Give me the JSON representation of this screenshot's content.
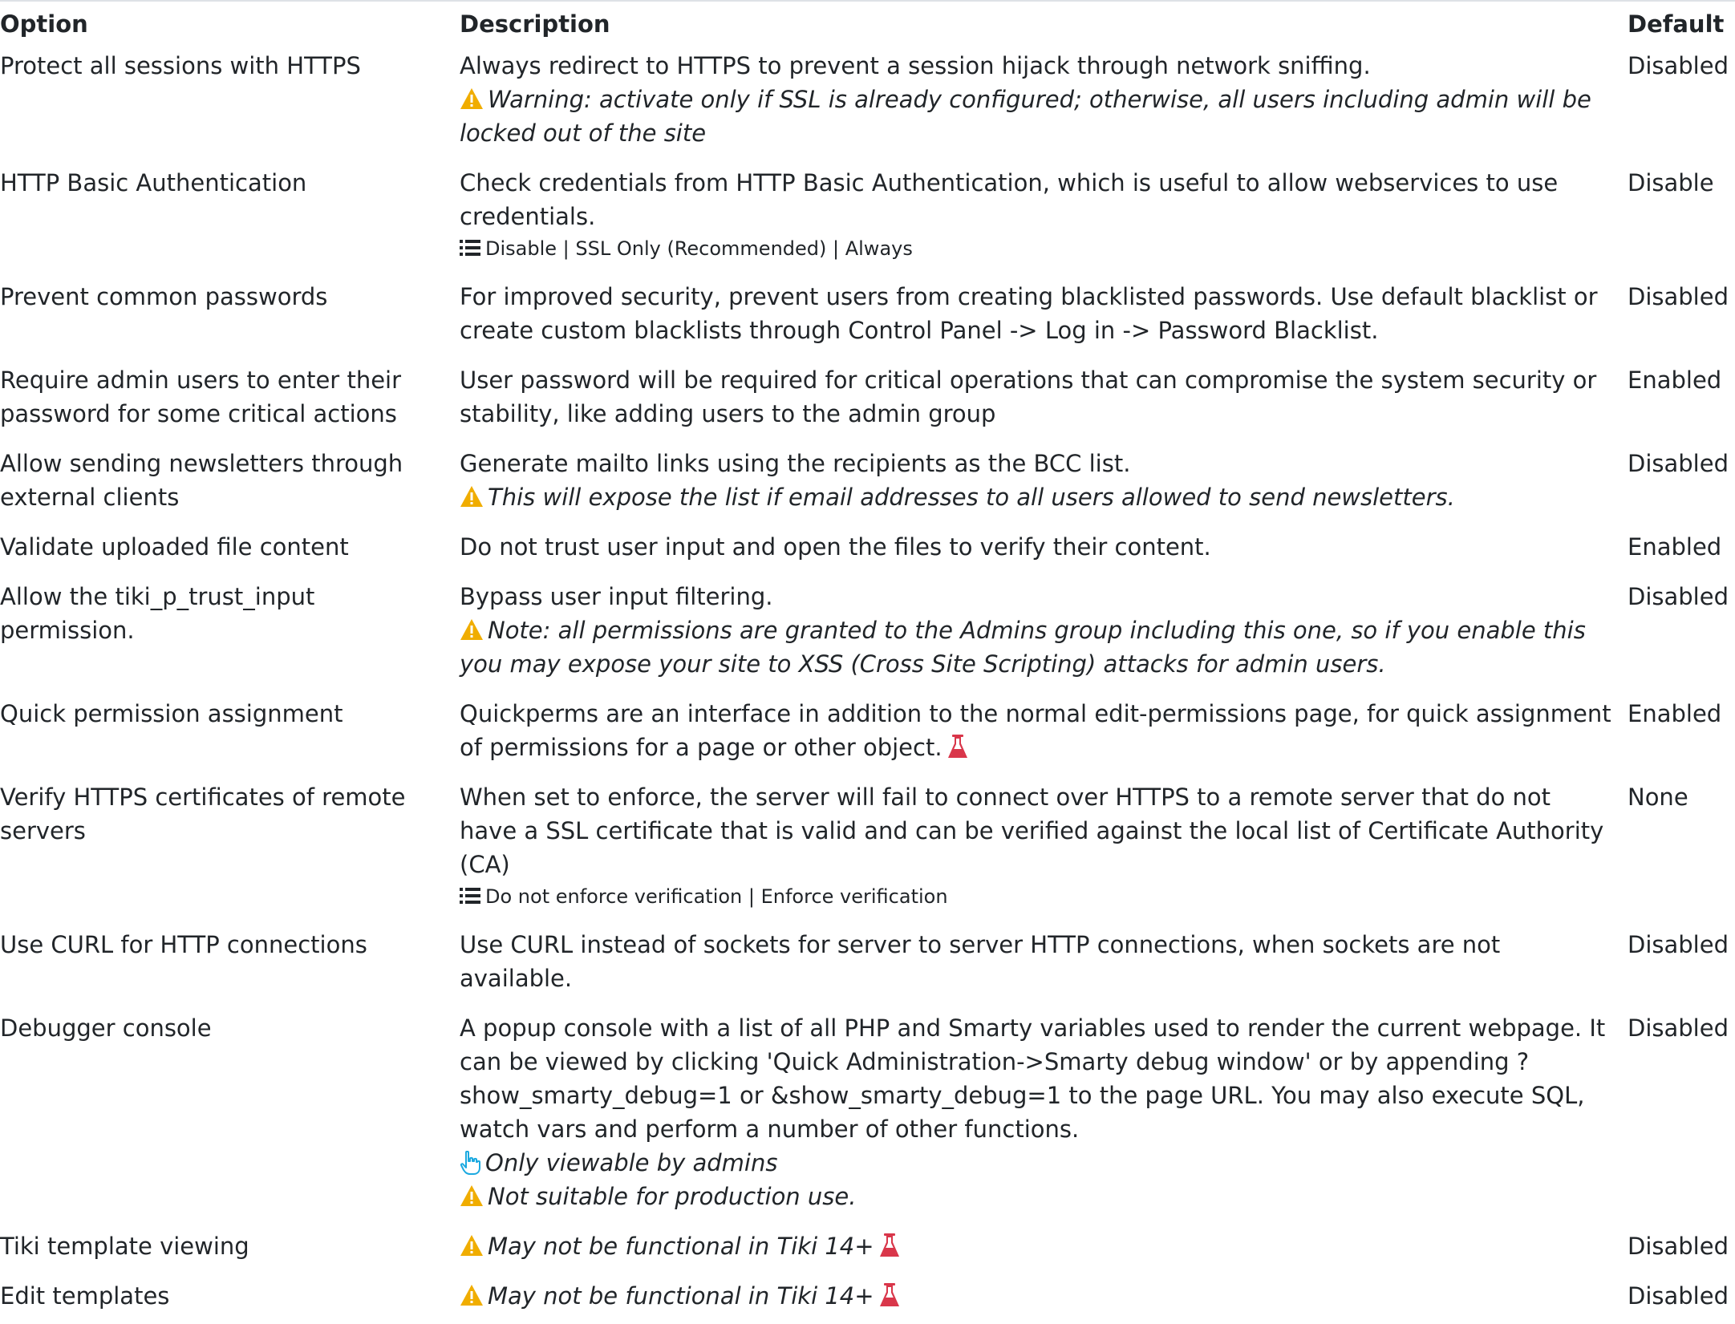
{
  "headers": {
    "option": "Option",
    "description": "Description",
    "default": "Default"
  },
  "colors": {
    "warning": "#f0ad00",
    "experimental": "#d9364a",
    "admin": "#1ba9e0"
  },
  "rows": [
    {
      "option": "Protect all sessions with HTTPS",
      "description": "Always redirect to HTTPS to prevent a session hijack through network sniffing.",
      "warning": "Warning: activate only if SSL is already configured; otherwise, all users including admin will be locked out of the site",
      "default": "Disabled"
    },
    {
      "option": "HTTP Basic Authentication",
      "description": "Check credentials from HTTP Basic Authentication, which is useful to allow webservices to use credentials.",
      "options": "Disable | SSL Only (Recommended) | Always",
      "default": "Disable"
    },
    {
      "option": "Prevent common passwords",
      "description": "For improved security, prevent users from creating blacklisted passwords. Use default blacklist or create custom blacklists through Control Panel -> Log in -> Password Blacklist.",
      "default": "Disabled"
    },
    {
      "option": "Require admin users to enter their password for some critical actions",
      "description": "User password will be required for critical operations that can compromise the system security or stability, like adding users to the admin group",
      "default": "Enabled"
    },
    {
      "option": "Allow sending newsletters through external clients",
      "description": "Generate mailto links using the recipients as the BCC list.",
      "warning": "This will expose the list if email addresses to all users allowed to send newsletters.",
      "default": "Disabled"
    },
    {
      "option": "Validate uploaded file content",
      "description": "Do not trust user input and open the files to verify their content.",
      "default": "Enabled"
    },
    {
      "option": "Allow the tiki_p_trust_input permission.",
      "description": "Bypass user input filtering.",
      "warning": "Note: all permissions are granted to the Admins group including this one, so if you enable this you may expose your site to XSS (Cross Site Scripting) attacks for admin users.",
      "default": "Disabled"
    },
    {
      "option": "Quick permission assignment",
      "description": "Quickperms are an interface in addition to the normal edit-permissions page, for quick assignment of permissions for a page or other object.",
      "default": "Enabled"
    },
    {
      "option": "Verify HTTPS certificates of remote servers",
      "description": "When set to enforce, the server will fail to connect over HTTPS to a remote server that do not have a SSL certificate that is valid and can be verified against the local list of Certificate Authority (CA)",
      "options": "Do not enforce verification | Enforce verification",
      "default": "None"
    },
    {
      "option": "Use CURL for HTTP connections",
      "description": "Use CURL instead of sockets for server to server HTTP connections, when sockets are not available.",
      "default": "Disabled"
    },
    {
      "option": "Debugger console",
      "description": "A popup console with a list of all PHP and Smarty variables used to render the current webpage. It can be viewed by clicking 'Quick Administration->Smarty debug window' or by appending ?show_smarty_debug=1 or &show_smarty_debug=1 to the page URL. You may also execute SQL, watch vars and perform a number of other functions.",
      "admin_note": "Only viewable by admins",
      "warning": "Not suitable for production use.",
      "default": "Disabled"
    },
    {
      "option": "Tiki template viewing",
      "warning": "May not be functional in Tiki 14+",
      "default": "Disabled"
    },
    {
      "option": "Edit templates",
      "warning": "May not be functional in Tiki 14+",
      "default": "Disabled"
    }
  ]
}
